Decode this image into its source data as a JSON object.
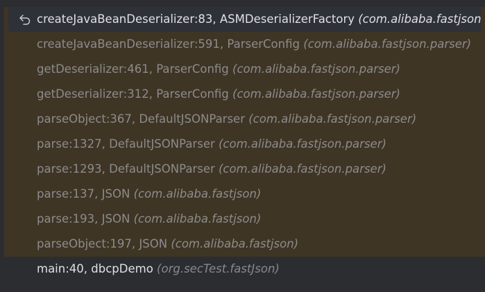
{
  "frames": [
    {
      "method": "createJavaBeanDeserializer:83, ASMDeserializerFactory",
      "package": "(com.alibaba.fastjson.parser.deserializer)",
      "icon": "return-arrow-icon"
    },
    {
      "method": "createJavaBeanDeserializer:591, ParserConfig",
      "package": "(com.alibaba.fastjson.parser)"
    },
    {
      "method": "getDeserializer:461, ParserConfig",
      "package": "(com.alibaba.fastjson.parser)"
    },
    {
      "method": "getDeserializer:312, ParserConfig",
      "package": "(com.alibaba.fastjson.parser)"
    },
    {
      "method": "parseObject:367, DefaultJSONParser",
      "package": "(com.alibaba.fastjson.parser)"
    },
    {
      "method": "parse:1327, DefaultJSONParser",
      "package": "(com.alibaba.fastjson.parser)"
    },
    {
      "method": "parse:1293, DefaultJSONParser",
      "package": "(com.alibaba.fastjson.parser)"
    },
    {
      "method": "parse:137, JSON",
      "package": "(com.alibaba.fastjson)"
    },
    {
      "method": "parse:193, JSON",
      "package": "(com.alibaba.fastjson)"
    },
    {
      "method": "parseObject:197, JSON",
      "package": "(com.alibaba.fastjson)"
    },
    {
      "method": "main:40, dbcpDemo",
      "package": "(org.secTest.fastJson)"
    }
  ],
  "colors": {
    "library_frame_bg": "#3f3525",
    "current_frame_bg": "#2e3138",
    "panel_bg": "#2b2d30",
    "library_text": "#8c8c8c",
    "normal_text": "#dfe1e5",
    "package_text": "#868a91"
  }
}
